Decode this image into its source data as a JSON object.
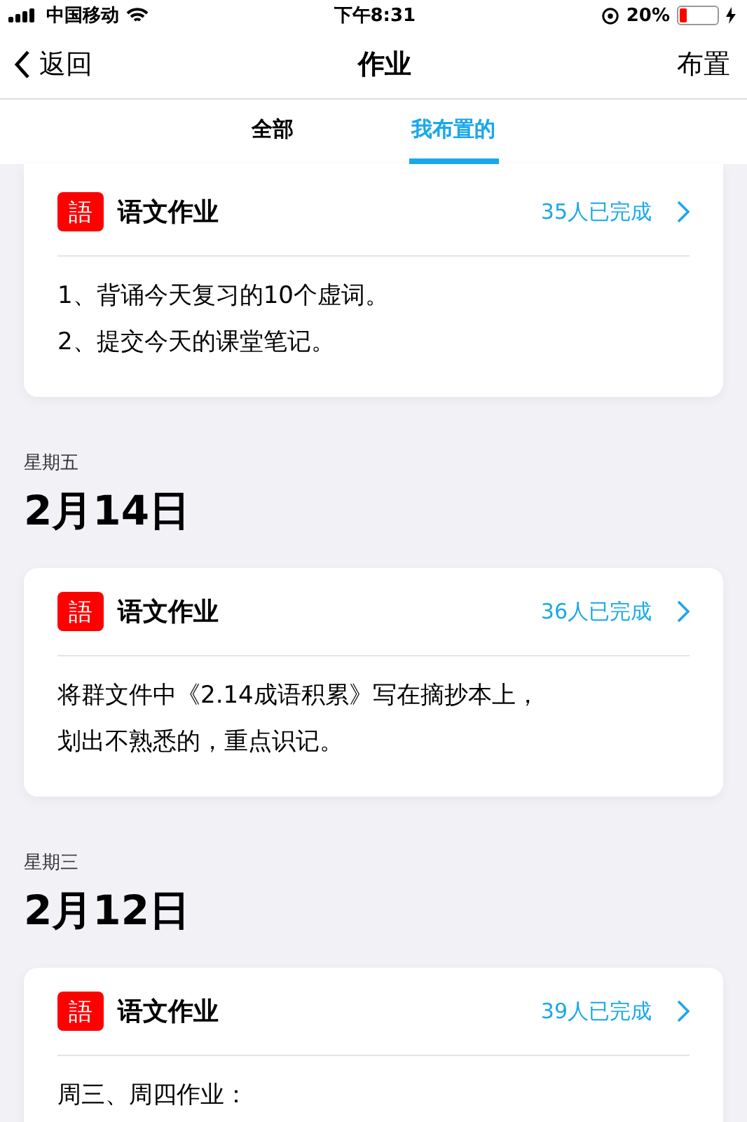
{
  "status_bar": {
    "carrier": "中国移动",
    "time": "下午8:31",
    "battery": "20%"
  },
  "nav": {
    "back": "返回",
    "title": "作业",
    "action": "布置"
  },
  "tabs": [
    {
      "label": "全部",
      "selected": false
    },
    {
      "label": "我布置的",
      "selected": true
    }
  ],
  "sections": [
    {
      "cards": [
        {
          "subject_icon": "語",
          "subject": "语文作业",
          "completed": "35人已完成",
          "lines": [
            "1、背诵今天复习的10个虚词。",
            "2、提交今天的课堂笔记。"
          ]
        }
      ]
    },
    {
      "weekday": "星期五",
      "date": "2月14日",
      "cards": [
        {
          "subject_icon": "語",
          "subject": "语文作业",
          "completed": "36人已完成",
          "lines": [
            "将群文件中《2.14成语积累》写在摘抄本上，",
            "划出不熟悉的，重点识记。"
          ]
        }
      ]
    },
    {
      "weekday": "星期三",
      "date": "2月12日",
      "cards": [
        {
          "subject_icon": "語",
          "subject": "语文作业",
          "completed": "39人已完成",
          "lines": [
            "周三、周四作业："
          ]
        }
      ]
    }
  ]
}
